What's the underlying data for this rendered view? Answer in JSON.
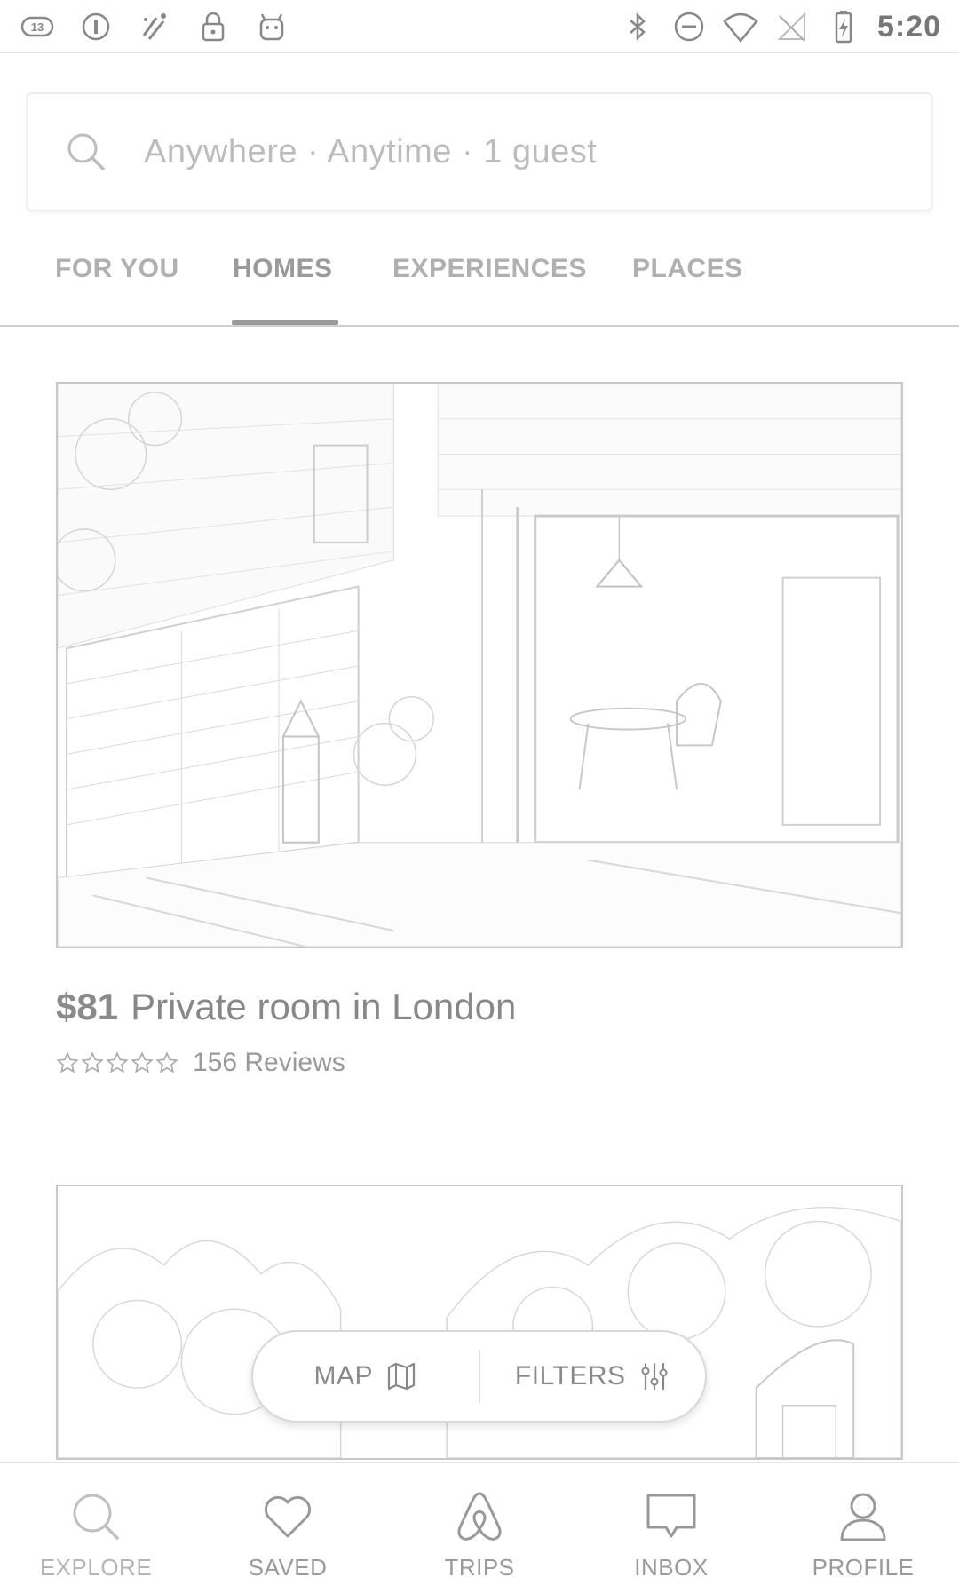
{
  "status_bar": {
    "time": "5:20",
    "left_icons": [
      "notification-13-icon",
      "circle-i-icon",
      "sparkle-icon",
      "lock-icon",
      "android-icon"
    ],
    "right_icons": [
      "bluetooth-icon",
      "do-not-disturb-icon",
      "wifi-icon",
      "no-signal-icon",
      "battery-charging-icon"
    ]
  },
  "search": {
    "placeholder": "Anywhere · Anytime · 1 guest"
  },
  "tabs": [
    {
      "label": "FOR YOU",
      "active": false
    },
    {
      "label": "HOMES",
      "active": true
    },
    {
      "label": "EXPERIENCES",
      "active": false
    },
    {
      "label": "PLACES",
      "active": false
    }
  ],
  "listings": [
    {
      "price": "$81",
      "title": "Private room in London",
      "stars": 5,
      "reviews": "156 Reviews"
    }
  ],
  "floating": {
    "map_label": "MAP",
    "filters_label": "FILTERS"
  },
  "bottom_nav": [
    {
      "label": "EXPLORE",
      "icon": "search-icon",
      "active": true
    },
    {
      "label": "SAVED",
      "icon": "heart-icon",
      "active": false
    },
    {
      "label": "TRIPS",
      "icon": "airbnb-logo-icon",
      "active": false
    },
    {
      "label": "INBOX",
      "icon": "chat-bubble-icon",
      "active": false
    },
    {
      "label": "PROFILE",
      "icon": "person-icon",
      "active": false
    }
  ]
}
